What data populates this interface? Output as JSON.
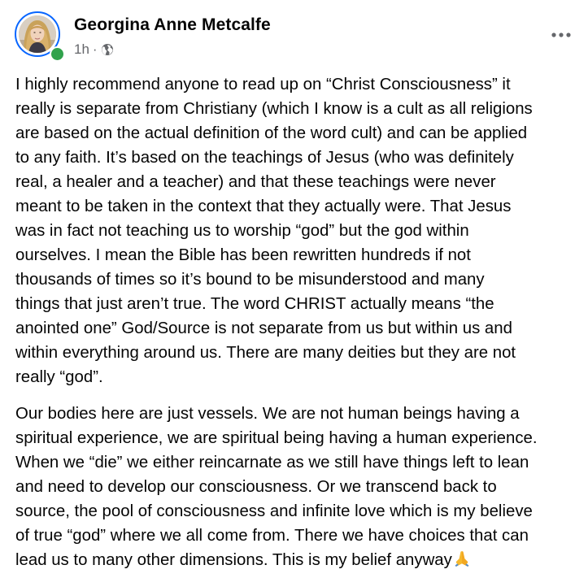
{
  "post": {
    "author_name": "Georgina Anne Metcalfe",
    "timestamp": "1h",
    "separator": "·",
    "audience_icon": "globe-icon",
    "more_icon": "more-horizontal-icon",
    "online_status_color": "#31a24c",
    "paragraphs": [
      "I highly recommend anyone to read up on “Christ Consciousness” it\nreally is separate from Christiany (which I know is a cult as all religions\nare based on the actual definition of the word cult) and can be applied\nto any faith. It’s based on the teachings of Jesus (who was definitely\nreal, a healer and a teacher) and that these teachings were never\nmeant to be taken in the context that they actually were. That Jesus\nwas in fact not teaching us to worship “god” but the god within\nourselves. I mean the Bible has been rewritten hundreds if not\nthousands of times so it’s bound to be misunderstood and many\nthings that just aren’t true. The word CHRIST actually means “the\nanointed one” God/Source is not separate from us but within us and\nwithin everything around us. There are many deities but they are not\nreally “god”.",
      "Our bodies here are just vessels. We are not human beings having a\nspiritual experience, we are spiritual being having a human experience.\nWhen we “die” we either reincarnate as we still have things left to lean\nand need to develop our consciousness. Or we transcend back to\nsource, the pool of consciousness and infinite love which is my believe\nof true “god” where we all come from. There we have choices that can\nlead us to many other dimensions. This is my belief anyway"
    ],
    "trailing_emoji": "folded-hands-emoji"
  }
}
